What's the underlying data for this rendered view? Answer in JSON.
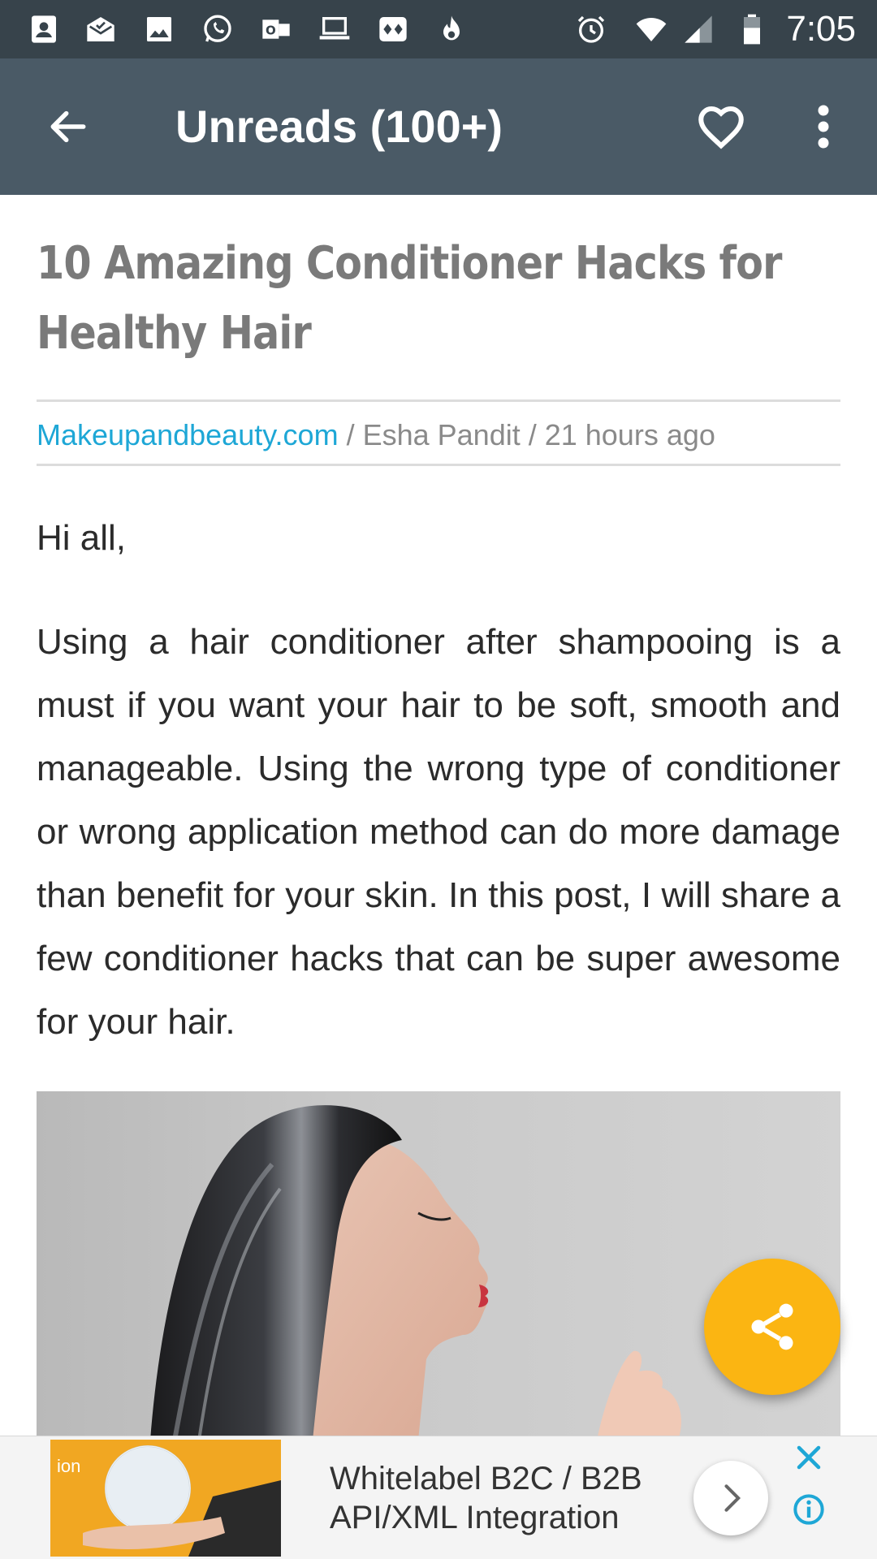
{
  "status_bar": {
    "time": "7:05",
    "left_icons": [
      "contacts-icon",
      "mail-icon",
      "image-icon",
      "whatsapp-icon",
      "outlook-icon",
      "laptop-icon",
      "cards-icon",
      "fire-icon"
    ],
    "right_icons": [
      "alarm-icon",
      "wifi-icon",
      "signal-icon",
      "battery-icon"
    ]
  },
  "app_bar": {
    "title": "Unreads (100+)",
    "back_icon": "arrow-left-icon",
    "favorite_icon": "heart-outline-icon",
    "menu_icon": "more-vert-icon"
  },
  "article": {
    "title": "10 Amazing Conditioner Hacks for Healthy Hair",
    "source": "Makeupandbeauty.com",
    "meta_rest": " / Esha Pandit / 21 hours ago",
    "greeting": "Hi all,",
    "body": "Using a hair conditioner after shampooing is a must if you want your hair to be soft, smooth and manageable. Using the wrong type of con­ditioner or wrong application method can do more damage than benefit for your skin. In this post, I will share a few conditioner hacks that can be super awesome for your hair."
  },
  "fab": {
    "icon": "share-icon"
  },
  "ad": {
    "text_line1": "Whitelabel B2C / B2B",
    "text_line2": "API/XML Integration",
    "image_caption": "ion",
    "arrow_icon": "chevron-right-icon",
    "close_icon": "close-icon",
    "info_icon": "info-icon"
  },
  "colors": {
    "status_bar": "#37434b",
    "app_bar": "#4a5a66",
    "link": "#1ea7d6",
    "fab": "#fbb512",
    "ad_accent": "#1ea7d6"
  }
}
